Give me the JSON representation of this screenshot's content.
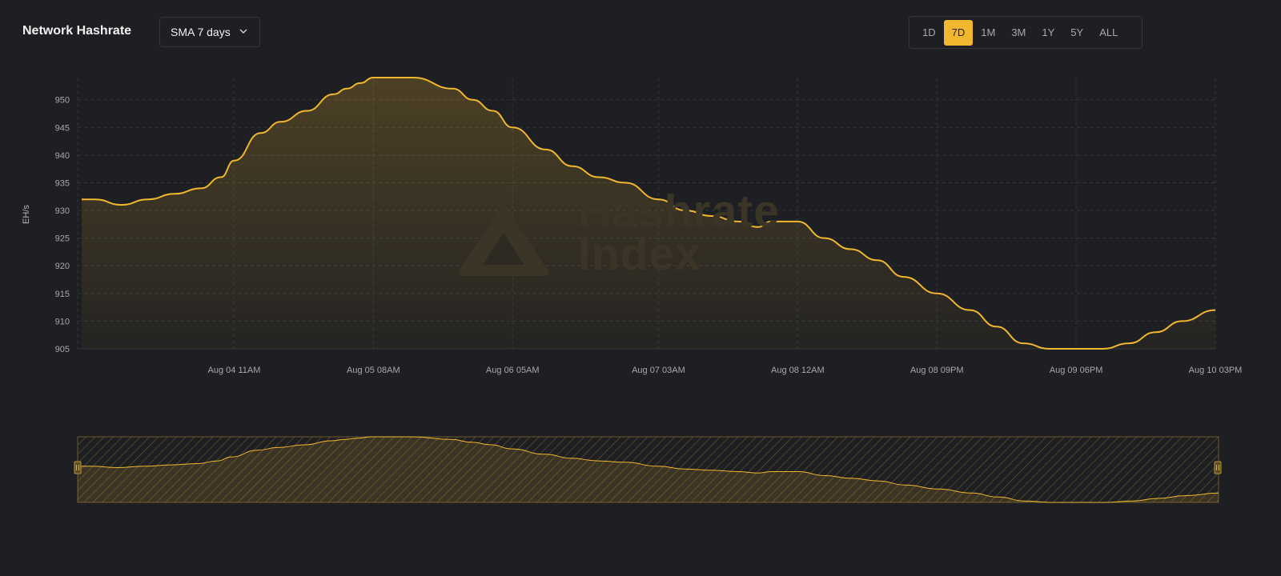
{
  "header": {
    "title": "Network Hashrate",
    "sma_label": "SMA 7 days",
    "ranges": [
      {
        "label": "1D",
        "active": false
      },
      {
        "label": "7D",
        "active": true
      },
      {
        "label": "1M",
        "active": false
      },
      {
        "label": "3M",
        "active": false
      },
      {
        "label": "1Y",
        "active": false
      },
      {
        "label": "5Y",
        "active": false
      },
      {
        "label": "ALL",
        "active": false
      }
    ]
  },
  "watermark": {
    "line1": "Hashrate",
    "line2": "Index"
  },
  "colors": {
    "accent": "#f0b72f",
    "background": "#1e1f22",
    "grid": "#34363b",
    "tick_text": "#a8a8ad"
  },
  "chart_data": {
    "type": "area",
    "title": "Network Hashrate",
    "ylabel": "EH/s",
    "xlabel": "",
    "grid": true,
    "ylim": [
      905,
      954
    ],
    "y_ticks": [
      905,
      910,
      915,
      920,
      925,
      930,
      935,
      940,
      945,
      950
    ],
    "xlim": [
      "2025-08-03 12:00",
      "2025-08-10 15:00"
    ],
    "x_ticks": [
      {
        "label": "Aug 04 11AM",
        "x": "2025-08-04 11:00"
      },
      {
        "label": "Aug 05 08AM",
        "x": "2025-08-05 08:00"
      },
      {
        "label": "Aug 06 05AM",
        "x": "2025-08-06 05:00"
      },
      {
        "label": "Aug 07 03AM",
        "x": "2025-08-07 03:00"
      },
      {
        "label": "Aug 08 12AM",
        "x": "2025-08-08 00:00"
      },
      {
        "label": "Aug 08 09PM",
        "x": "2025-08-08 21:00"
      },
      {
        "label": "Aug 09 06PM",
        "x": "2025-08-09 18:00"
      },
      {
        "label": "Aug 10 03PM",
        "x": "2025-08-10 15:00"
      }
    ],
    "series": [
      {
        "x": [
          "2025-08-03 12:00",
          "2025-08-03 14:00",
          "2025-08-03 18:00",
          "2025-08-03 22:00",
          "2025-08-04 02:00",
          "2025-08-04 06:00",
          "2025-08-04 09:00",
          "2025-08-04 11:00",
          "2025-08-04 15:00",
          "2025-08-04 18:00",
          "2025-08-04 22:00",
          "2025-08-05 02:00",
          "2025-08-05 04:00",
          "2025-08-05 06:00",
          "2025-08-05 08:00",
          "2025-08-05 14:00",
          "2025-08-05 20:00",
          "2025-08-05 23:00",
          "2025-08-06 02:00",
          "2025-08-06 05:00",
          "2025-08-06 10:00",
          "2025-08-06 14:00",
          "2025-08-06 18:00",
          "2025-08-06 22:00",
          "2025-08-07 03:00",
          "2025-08-07 07:00",
          "2025-08-07 11:00",
          "2025-08-07 15:00",
          "2025-08-07 18:00",
          "2025-08-07 20:00",
          "2025-08-08 00:00",
          "2025-08-08 04:00",
          "2025-08-08 08:00",
          "2025-08-08 12:00",
          "2025-08-08 16:00",
          "2025-08-08 21:00",
          "2025-08-09 02:00",
          "2025-08-09 06:00",
          "2025-08-09 10:00",
          "2025-08-09 14:00",
          "2025-08-09 18:00",
          "2025-08-09 22:00",
          "2025-08-10 02:00",
          "2025-08-10 06:00",
          "2025-08-10 10:00",
          "2025-08-10 15:00"
        ],
        "values": [
          932,
          932,
          931,
          932,
          933,
          934,
          936,
          939,
          944,
          946,
          948,
          951,
          952,
          953,
          954,
          954,
          952,
          950,
          948,
          945,
          941,
          938,
          936,
          935,
          932,
          930,
          929,
          928,
          927,
          928,
          928,
          925,
          923,
          921,
          918,
          915,
          912,
          909,
          906,
          905,
          905,
          905,
          906,
          908,
          910,
          912
        ]
      }
    ]
  }
}
